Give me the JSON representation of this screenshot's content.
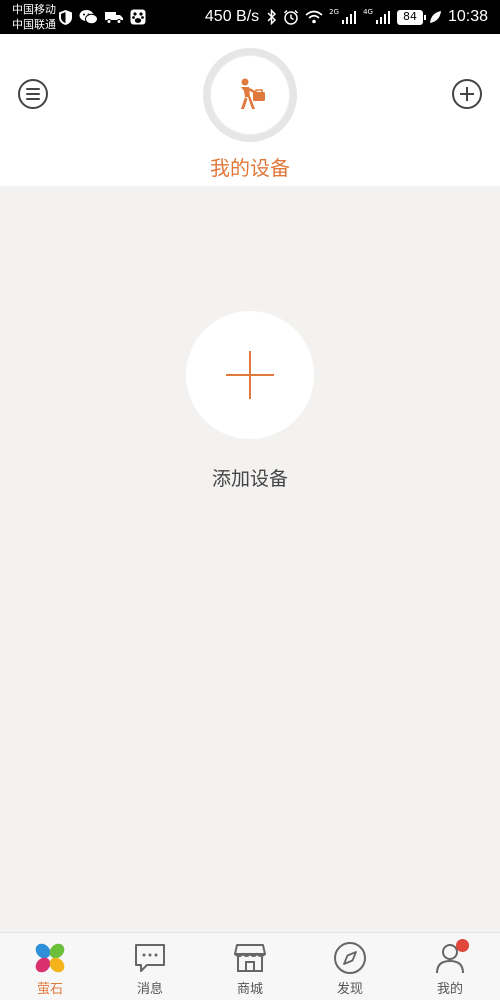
{
  "status_bar": {
    "carrier_1": "中国移动",
    "carrier_2": "中国联通",
    "net_speed": "450 B/s",
    "net_2g": "2G",
    "net_4g": "4G",
    "battery": "84",
    "time": "10:38",
    "icons": [
      "shield-icon",
      "wechat-icon",
      "truck-icon",
      "baidu-icon",
      "bluetooth-icon",
      "alarm-icon",
      "wifi-icon",
      "signal-icon",
      "leaf-icon"
    ]
  },
  "header": {
    "title": "我的设备",
    "menu_icon": "menu-icon",
    "add_icon": "plus-icon",
    "avatar_icon": "worker-icon"
  },
  "main": {
    "add_device_label": "添加设备"
  },
  "bottom_nav": {
    "items": [
      {
        "label": "萤石",
        "icon": "ezviz-icon",
        "active": true
      },
      {
        "label": "消息",
        "icon": "message-icon",
        "active": false
      },
      {
        "label": "商城",
        "icon": "store-icon",
        "active": false
      },
      {
        "label": "发现",
        "icon": "compass-icon",
        "active": false
      },
      {
        "label": "我的",
        "icon": "user-icon",
        "active": false,
        "badge": true
      }
    ]
  },
  "colors": {
    "accent": "#e07a3c",
    "badge": "#e0463a",
    "background": "#f3f2f0"
  }
}
